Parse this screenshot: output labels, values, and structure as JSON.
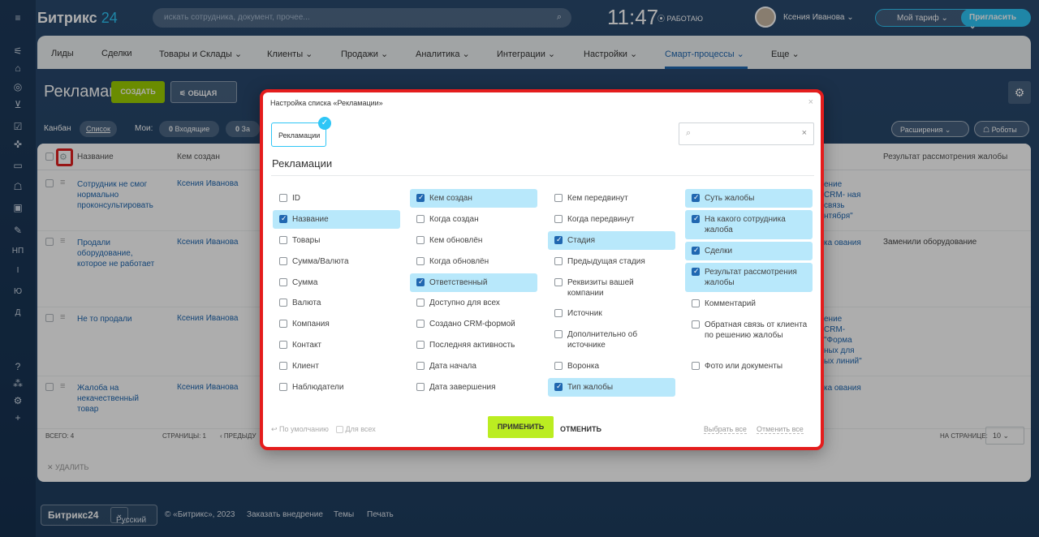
{
  "leftbar": {
    "icons": [
      "menu-icon",
      "filter-icon",
      "home-icon",
      "target-icon",
      "cart-icon",
      "check-icon",
      "puzzle-icon",
      "card-icon",
      "robot-icon",
      "box-icon",
      "pen-icon"
    ],
    "letters": [
      "НП",
      "I",
      "Ю",
      "Д"
    ]
  },
  "top": {
    "logo_a": "Битрикс",
    "logo_b": "24",
    "search_placeholder": "искать сотрудника, документ, прочее...",
    "clock": "11:47",
    "status": "РАБОТАЮ",
    "user": "Ксения Иванова",
    "tariff": "Мой тариф",
    "invite": "Пригласить"
  },
  "menu": [
    "Лиды",
    "Сделки",
    "Товары и Склады",
    "Клиенты",
    "Продажи",
    "Аналитика",
    "Интеграции",
    "Настройки",
    "Смарт-процессы",
    "Еще"
  ],
  "page": {
    "title": "Рекламации",
    "create": "СОЗДАТЬ",
    "general": "ОБЩАЯ"
  },
  "view": {
    "kanban": "Канбан",
    "list": "Список",
    "mine": "Мои:",
    "incoming_count": "0",
    "incoming": "Входящие",
    "c2": "0",
    "c2label": "За",
    "ext": "Расширения",
    "robots": "Роботы"
  },
  "grid": {
    "h_name": "Название",
    "h_author": "Кем создан",
    "h_result": "Результат рассмотрения жалобы",
    "rows": [
      {
        "name": "Сотрудник не смог нормально проконсультировать",
        "author": "Ксения Иванова",
        "right": "ение CRM- ная связь нтября\"",
        "result": ""
      },
      {
        "name": "Продали оборудование, которое не работает",
        "author": "Ксения Иванова",
        "right": "ка ования",
        "result": "Заменили оборудование"
      },
      {
        "name": "Не то продали",
        "author": "Ксения Иванова",
        "right": "ение CRM- \"Форма ных для ых линий\"",
        "result": ""
      },
      {
        "name": "Жалоба на некачественный товар",
        "author": "Ксения Иванова",
        "right": "ка ования",
        "result": ""
      }
    ],
    "total": "ВСЕГО: 4",
    "pages": "СТРАНИЦЫ: 1",
    "prev": "ПРЕДЫДУ",
    "per_page": "НА СТРАНИЦЕ:",
    "per_page_val": "10",
    "delete": "УДАЛИТЬ"
  },
  "footer": {
    "logo": "Битрикс24",
    "lang": "Русский",
    "copy": "© «Битрикс», 2023",
    "order": "Заказать внедрение",
    "themes": "Темы",
    "print": "Печать"
  },
  "modal": {
    "title": "Настройка списка «Рекламации»",
    "tag": "Рекламации",
    "section": "Рекламации",
    "col1": [
      [
        "ID",
        false
      ],
      [
        "Название",
        true
      ],
      [
        "Товары",
        false
      ],
      [
        "Сумма/Валюта",
        false
      ],
      [
        "Сумма",
        false
      ],
      [
        "Валюта",
        false
      ],
      [
        "Компания",
        false
      ],
      [
        "Контакт",
        false
      ],
      [
        "Клиент",
        false
      ],
      [
        "Наблюдатели",
        false
      ]
    ],
    "col2": [
      [
        "Кем создан",
        true
      ],
      [
        "Когда создан",
        false
      ],
      [
        "Кем обновлён",
        false
      ],
      [
        "Когда обновлён",
        false
      ],
      [
        "Ответственный",
        true
      ],
      [
        "Доступно для всех",
        false
      ],
      [
        "Создано CRM-формой",
        false
      ],
      [
        "Последняя активность",
        false
      ],
      [
        "Дата начала",
        false
      ],
      [
        "Дата завершения",
        false
      ]
    ],
    "col3": [
      [
        "Кем передвинут",
        false
      ],
      [
        "Когда передвинут",
        false
      ],
      [
        "Стадия",
        true
      ],
      [
        "Предыдущая стадия",
        false
      ],
      [
        "Реквизиты вашей компании",
        false
      ],
      [
        "Источник",
        false
      ],
      [
        "Дополнительно об источнике",
        false
      ],
      [
        "Воронка",
        false
      ],
      [
        "Тип жалобы",
        true
      ]
    ],
    "col4": [
      [
        "Суть жалобы",
        true
      ],
      [
        "На какого сотрудника жалоба",
        true
      ],
      [
        "Сделки",
        true
      ],
      [
        "Результат рассмотрения жалобы",
        true
      ],
      [
        "Комментарий",
        false
      ],
      [
        "Обратная связь от клиента по решению жалобы",
        false
      ],
      [
        "Фото или документы",
        false
      ]
    ],
    "default": "По умолчанию",
    "for_all": "Для всех",
    "apply": "ПРИМЕНИТЬ",
    "cancel": "ОТМЕНИТЬ",
    "select_all": "Выбрать все",
    "deselect_all": "Отменить все"
  }
}
